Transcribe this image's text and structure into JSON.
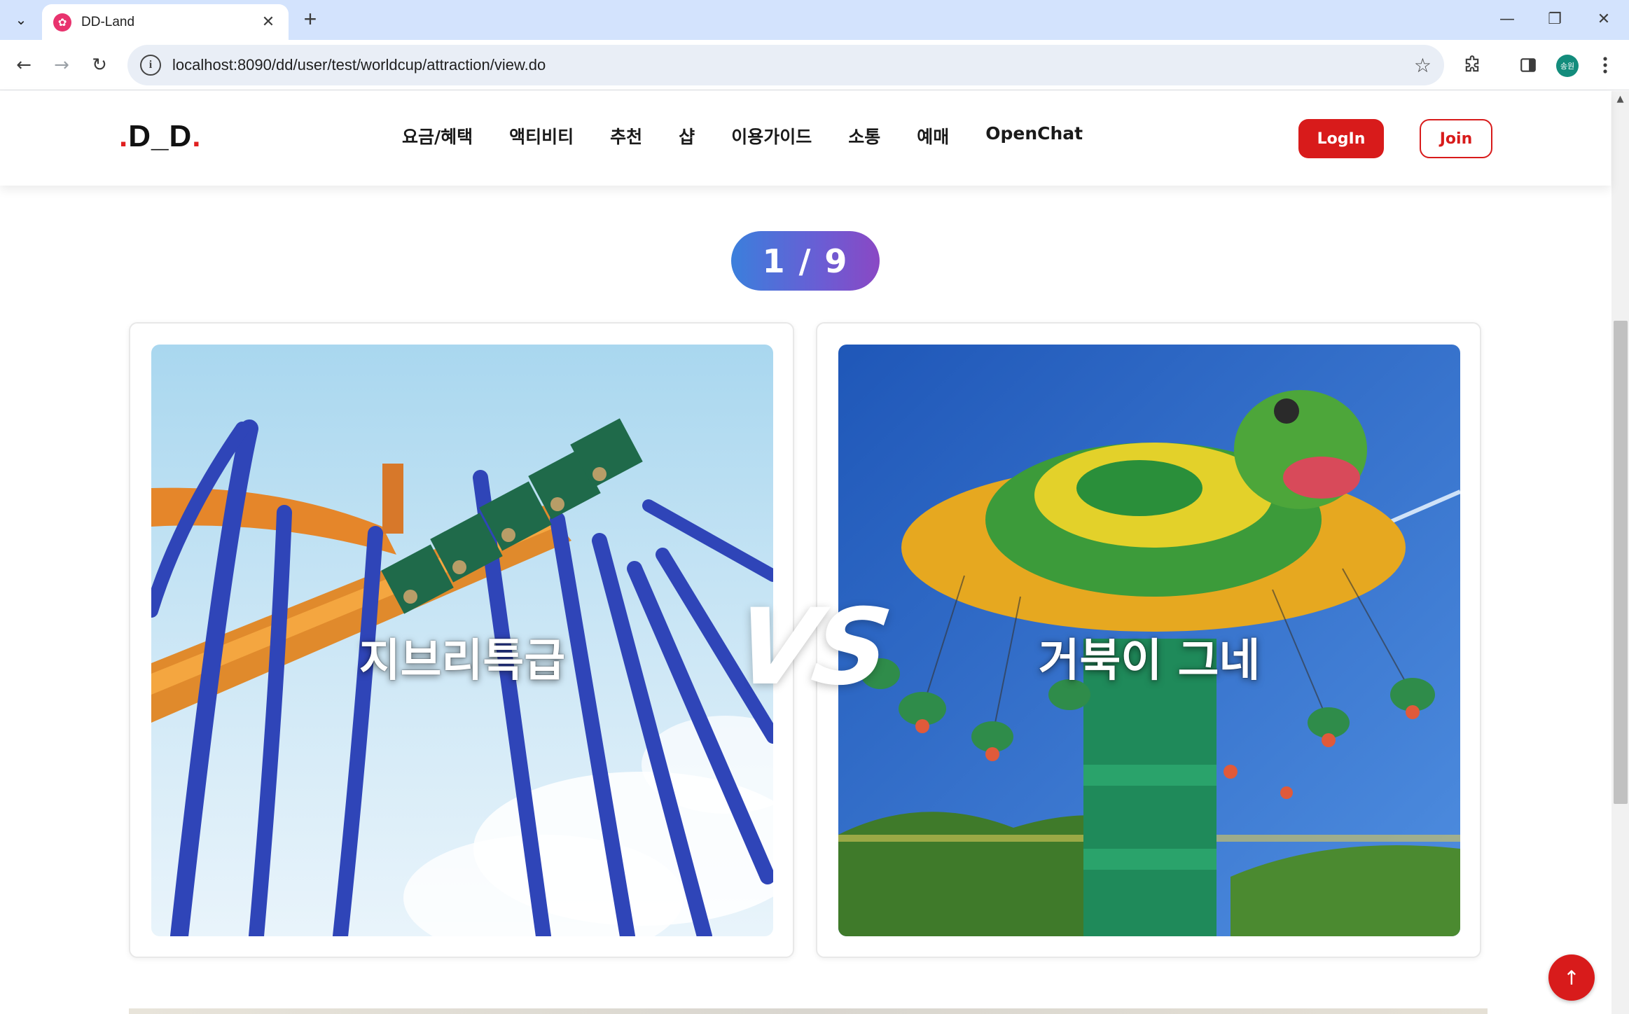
{
  "browser": {
    "tab_title": "DD-Land",
    "tab_close": "✕",
    "new_tab": "+",
    "url": "localhost:8090/dd/user/test/worldcup/attraction/view.do",
    "site_info": "i",
    "profile_initials": "송원"
  },
  "header": {
    "logo": {
      "dot": ".",
      "text": "D_D"
    },
    "nav": [
      {
        "label": "요금/혜택"
      },
      {
        "label": "액티비티"
      },
      {
        "label": "추천"
      },
      {
        "label": "샵"
      },
      {
        "label": "이용가이드"
      },
      {
        "label": "소통"
      },
      {
        "label": "예매"
      },
      {
        "label": "OpenChat"
      }
    ],
    "login_label": "LogIn",
    "join_label": "Join"
  },
  "worldcup": {
    "round_progress": "1 / 9",
    "vs_label": "VS",
    "candidates": [
      {
        "name": "지브리특급"
      },
      {
        "name": "거북이 그네"
      }
    ]
  },
  "colors": {
    "brand_red": "#d81b1b",
    "badge_gradient_start": "#3b7fdc",
    "badge_gradient_end": "#8a48c4"
  },
  "icons": {
    "scroll_top": "arrow-up-icon"
  }
}
